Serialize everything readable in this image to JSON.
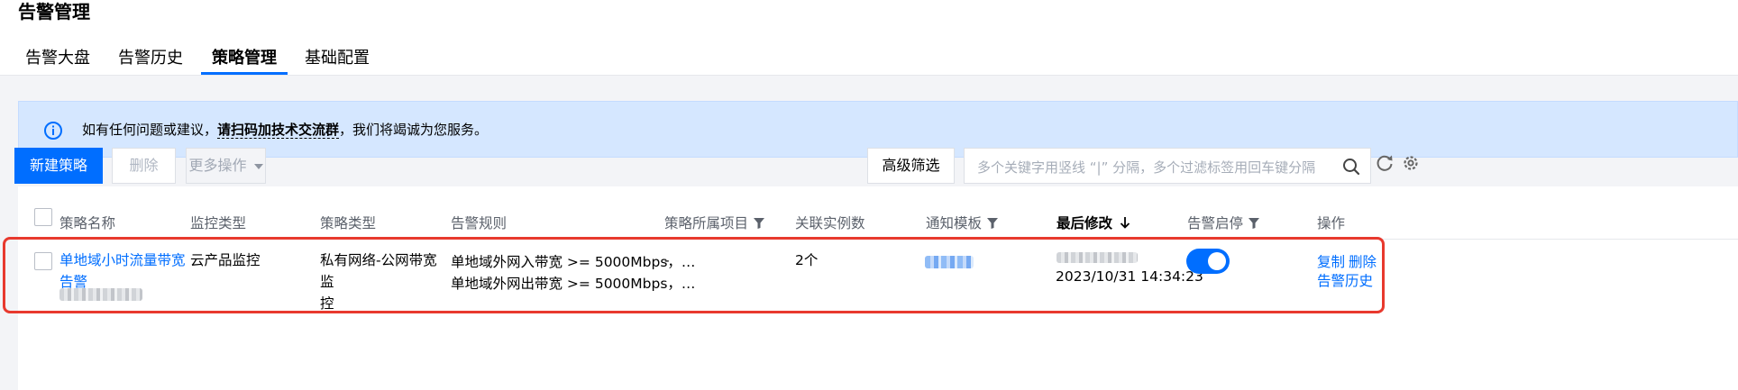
{
  "page": {
    "title": "告警管理"
  },
  "tabs": [
    {
      "label": "告警大盘",
      "active": false
    },
    {
      "label": "告警历史",
      "active": false
    },
    {
      "label": "策略管理",
      "active": true
    },
    {
      "label": "基础配置",
      "active": false
    }
  ],
  "notice": {
    "icon": "info-icon",
    "prefix": "如有任何问题或建议，",
    "link": "请扫码加技术交流群",
    "suffix": "，我们将竭诚为您服务。"
  },
  "toolbar": {
    "create_label": "新建策略",
    "delete_label": "删除",
    "more_label": "更多操作",
    "advanced_filter_label": "高级筛选"
  },
  "search": {
    "placeholder": "多个关键字用竖线 “|” 分隔，多个过滤标签用回车键分隔"
  },
  "table": {
    "headers": {
      "name": "策略名称",
      "monitor_type": "监控类型",
      "policy_type": "策略类型",
      "rules": "告警规则",
      "project": "策略所属项目",
      "instances": "关联实例数",
      "template": "通知模板",
      "last_modified": "最后修改",
      "alarm_status": "告警启停",
      "actions": "操作"
    },
    "rows": [
      {
        "name_line1": "单地域小时流量带宽",
        "name_line2": "告警",
        "monitor_type": "云产品监控",
        "policy_type_line1": "私有网络-公网带宽监",
        "policy_type_line2": "控",
        "rule1": "单地域外网入带宽 >= 5000Mbps，…",
        "rule2": "单地域外网出带宽 >= 5000Mbps，…",
        "project": "-",
        "instances": "2个",
        "modified_time": "2023/10/31 14:34:23",
        "alarm_enabled": true,
        "action_copy": "复制",
        "action_delete": "删除",
        "action_history": "告警历史"
      }
    ]
  },
  "colors": {
    "accent": "#006eff",
    "notice_bg": "#d5e7ff",
    "highlight": "#e8392e"
  }
}
